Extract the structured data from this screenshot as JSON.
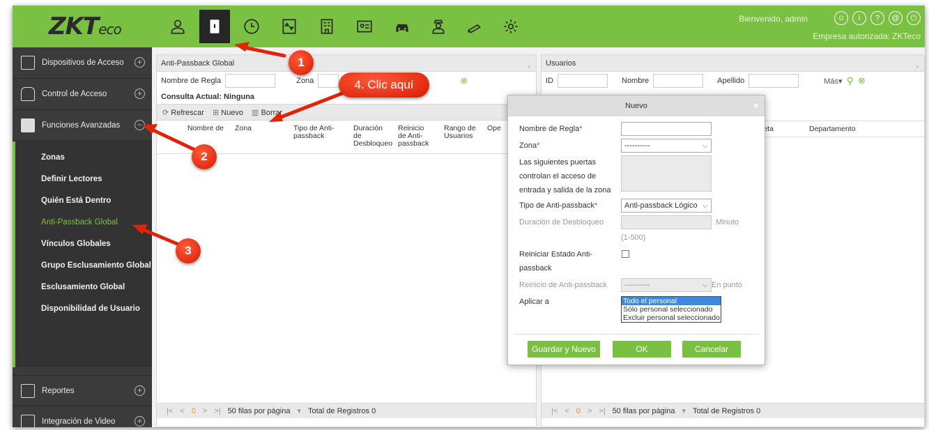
{
  "app": {
    "logo_main": "ZKT",
    "logo_suffix": "eco",
    "welcome": "Bienvenido, admin",
    "company": "Empresa autorizada: ZKTeco"
  },
  "top_icons": [
    "person-icon",
    "door-icon",
    "clock-icon",
    "elevator-icon",
    "building-icon",
    "visitor-icon",
    "car-icon",
    "guard-icon",
    "camera-icon",
    "settings-icon"
  ],
  "sidebar": {
    "menus": [
      {
        "label": "Dispositivos de Acceso"
      },
      {
        "label": "Control de Acceso"
      },
      {
        "label": "Funciones Avanzadas"
      }
    ],
    "items": [
      {
        "label": "Zonas"
      },
      {
        "label": "Definir Lectores"
      },
      {
        "label": "Quién Está Dentro"
      },
      {
        "label": "Anti-Passback Global"
      },
      {
        "label": "Vínculos Globales"
      },
      {
        "label": "Grupo Esclusamiento Global"
      },
      {
        "label": "Esclusamiento Global"
      },
      {
        "label": "Disponibilidad de Usuario"
      }
    ],
    "bottom": [
      {
        "label": "Reportes"
      },
      {
        "label": "Integración de Video"
      }
    ]
  },
  "left_panel": {
    "title": "Anti-Passback Global",
    "filter_rule": "Nombre de Regla",
    "filter_zone": "Zona",
    "query": "Consulta Actual: Ninguna",
    "refresh": "Refrescar",
    "new": "Nuevo",
    "delete": "Borrar",
    "columns": [
      "Nombre de",
      "Zona",
      "Tipo de Anti- passback",
      "Duración de Desbloqueo",
      "Reinicio de Anti- passback",
      "Rango de Usuarios",
      "Ope"
    ],
    "pager": {
      "first": "|<",
      "prev": "<",
      "page": "0",
      "next": ">",
      "last": ">|",
      "rows": "50 filas por página",
      "total": "Total de Registros 0"
    }
  },
  "right_panel": {
    "title": "Usuarios",
    "filter_id": "ID",
    "filter_name": "Nombre",
    "filter_last": "Apellido",
    "more": "Más",
    "columns": [
      "jeta",
      "Departamento"
    ],
    "pager": {
      "first": "|<",
      "prev": "<",
      "page": "0",
      "next": ">",
      "last": ">|",
      "rows": "50 filas por página",
      "total": "Total de Registros 0"
    }
  },
  "dialog": {
    "title": "Nuevo",
    "rule_name": "Nombre de Regla",
    "zone": "Zona",
    "zone_value": "----------",
    "doors_l1": "Las siguientes puertas",
    "doors_l2": "controlan el acceso de",
    "doors_l3": "entrada y salida de la zona",
    "apb_type": "Tipo de Anti-passback",
    "apb_type_value": "Anti-passback Lógico",
    "unlock": "Duración de Desbloqueo",
    "unlock_unit": "Minuto",
    "unlock_range": "(1-500)",
    "reset_l1": "Reiniciar Estado Anti-",
    "reset_l2": "passback",
    "reset_time": "Reinicio de Anti-passback",
    "reset_time_value": "----------",
    "reset_unit": "En punto",
    "apply": "Aplicar a",
    "options": [
      "Todo el personal",
      "Sólo personal seleccionado",
      "Excluir personal seleccionado"
    ],
    "save_new": "Guardar y Nuevo",
    "ok": "OK",
    "cancel": "Cancelar"
  },
  "annotations": {
    "b1": "1",
    "b2": "2",
    "b3": "3",
    "b4": "4. Clic aquí"
  }
}
